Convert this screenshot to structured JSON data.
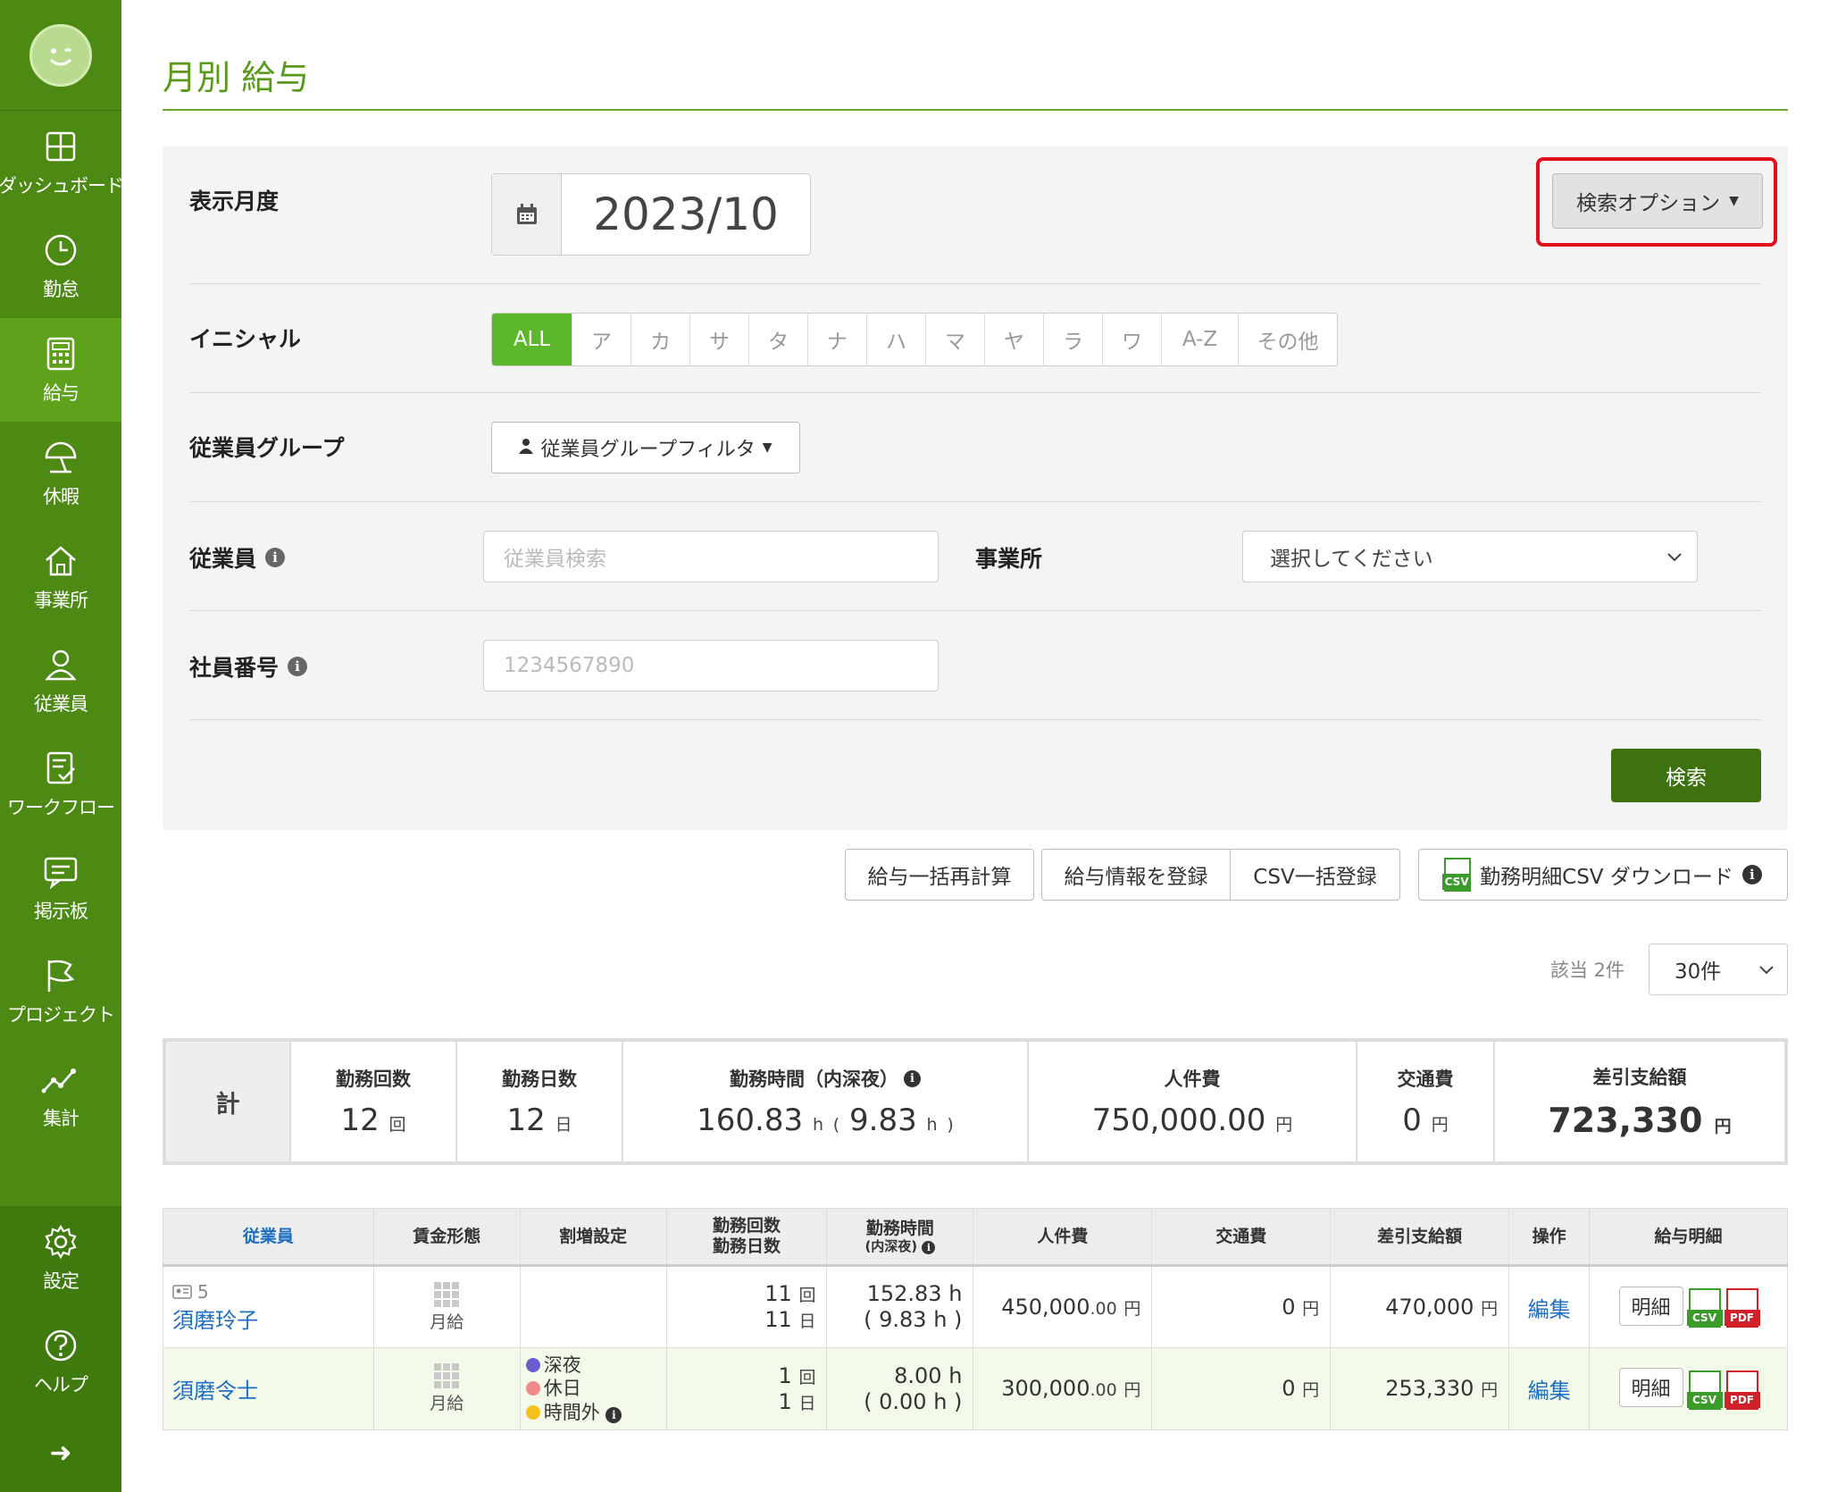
{
  "sidebar": {
    "items": [
      {
        "label": "ダッシュボード",
        "icon": "dashboard-icon"
      },
      {
        "label": "勤怠",
        "icon": "clock-icon"
      },
      {
        "label": "給与",
        "icon": "calculator-icon"
      },
      {
        "label": "休暇",
        "icon": "umbrella-icon"
      },
      {
        "label": "事業所",
        "icon": "home-icon"
      },
      {
        "label": "従業員",
        "icon": "person-icon"
      },
      {
        "label": "ワークフロー",
        "icon": "checklist-icon"
      },
      {
        "label": "掲示板",
        "icon": "chat-icon"
      },
      {
        "label": "プロジェクト",
        "icon": "flag-icon"
      },
      {
        "label": "集計",
        "icon": "chart-icon"
      }
    ],
    "active": "給与",
    "bottom": [
      {
        "label": "設定",
        "icon": "gear-icon"
      },
      {
        "label": "ヘルプ",
        "icon": "help-icon"
      }
    ],
    "expand_glyph": "➜"
  },
  "page": {
    "title": "月別 給与"
  },
  "search": {
    "month_label": "表示月度",
    "month_value": "2023/10",
    "options_button": "検索オプション",
    "initial_label": "イニシャル",
    "initials": [
      "ALL",
      "ア",
      "カ",
      "サ",
      "タ",
      "ナ",
      "ハ",
      "マ",
      "ヤ",
      "ラ",
      "ワ",
      "A-Z",
      "その他"
    ],
    "group_label": "従業員グループ",
    "group_button": "従業員グループフィルタ",
    "employee_label": "従業員",
    "employee_placeholder": "従業員検索",
    "office_label": "事業所",
    "office_select": "選択してください",
    "number_label": "社員番号",
    "number_placeholder": "1234567890",
    "search_button": "検索"
  },
  "actions": {
    "recalc": "給与一括再計算",
    "register": "給与情報を登録",
    "csv_register": "CSV一括登録",
    "download": "勤務明細CSV ダウンロード"
  },
  "listing": {
    "count": "該当 2件",
    "per_page": "30件"
  },
  "totals": {
    "head": "計",
    "work_count_label": "勤務回数",
    "work_count": "12",
    "work_count_unit": "回",
    "work_days_label": "勤務日数",
    "work_days": "12",
    "work_days_unit": "日",
    "work_hours_label": "勤務時間（内深夜）",
    "work_hours": "160.83",
    "night_hours": "9.83",
    "hours_unit": "h",
    "labor_label": "人件費",
    "labor": "750,000.00",
    "yen": "円",
    "transport_label": "交通費",
    "transport": "0",
    "net_label": "差引支給額",
    "net": "723,330"
  },
  "table": {
    "headers": {
      "employee": "従業員",
      "wage_type": "賃金形態",
      "premium": "割増設定",
      "count_days_1": "勤務回数",
      "count_days_2": "勤務日数",
      "hours_1": "勤務時間",
      "hours_2": "(内深夜)",
      "labor": "人件費",
      "transport": "交通費",
      "net": "差引支給額",
      "ops": "操作",
      "payslip": "給与明細"
    },
    "rows": [
      {
        "emp_no": "5",
        "name": "須磨玲子",
        "wage": "月給",
        "settings": [],
        "count": "11",
        "count_unit": "回",
        "days": "11",
        "days_unit": "日",
        "hours": "152.83",
        "night": "9.83",
        "h": "h",
        "labor_int": "450,000",
        "labor_dec": ".00",
        "yen": "円",
        "transport": "0",
        "net": "470,000",
        "edit": "編集",
        "detail": "明細"
      },
      {
        "emp_no": "",
        "name": "須磨令士",
        "wage": "月給",
        "settings": [
          {
            "label": "深夜",
            "color": "#6b5fcf"
          },
          {
            "label": "休日",
            "color": "#f28a8a"
          },
          {
            "label": "時間外",
            "color": "#f4c21a"
          }
        ],
        "count": "1",
        "count_unit": "回",
        "days": "1",
        "days_unit": "日",
        "hours": "8.00",
        "night": "0.00",
        "h": "h",
        "labor_int": "300,000",
        "labor_dec": ".00",
        "yen": "円",
        "transport": "0",
        "net": "253,330",
        "edit": "編集",
        "detail": "明細"
      }
    ],
    "file_tags": {
      "csv": "CSV",
      "pdf": "PDF"
    }
  },
  "colors": {
    "sidebar": "#4c8a14",
    "accent": "#5a9a1a",
    "link": "#1d6fc4",
    "highlight": "#e0101d"
  }
}
